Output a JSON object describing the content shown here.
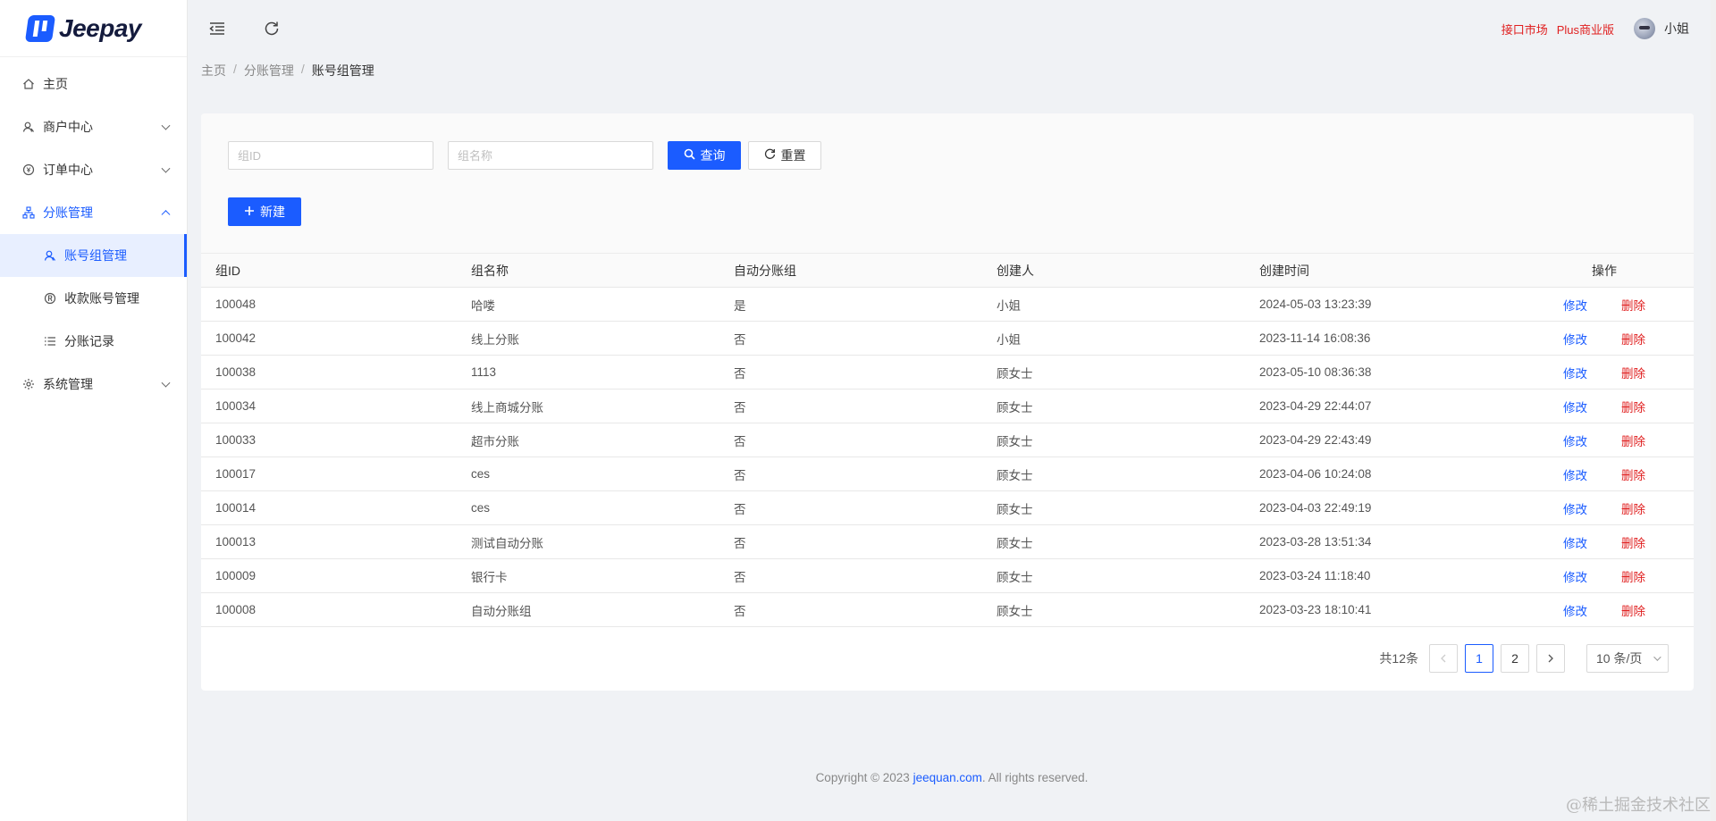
{
  "app": {
    "logo_text": "Jeepay"
  },
  "sidebar": {
    "items": [
      {
        "label": "主页",
        "icon": "home-icon"
      },
      {
        "label": "商户中心",
        "icon": "user-icon"
      },
      {
        "label": "订单中心",
        "icon": "yen-icon"
      },
      {
        "label": "分账管理",
        "icon": "cluster-icon"
      },
      {
        "label": "系统管理",
        "icon": "gear-icon"
      }
    ],
    "sub_items": [
      {
        "label": "账号组管理",
        "icon": "user-icon"
      },
      {
        "label": "收款账号管理",
        "icon": "registered-icon"
      },
      {
        "label": "分账记录",
        "icon": "list-icon"
      }
    ]
  },
  "header": {
    "links": [
      "接口市场",
      "Plus商业版"
    ],
    "username": "小姐"
  },
  "breadcrumb": [
    "主页",
    "分账管理",
    "账号组管理"
  ],
  "search": {
    "group_id_placeholder": "组ID",
    "group_name_placeholder": "组名称",
    "search_label": "查询",
    "reset_label": "重置",
    "new_label": "新建"
  },
  "table": {
    "columns": [
      "组ID",
      "组名称",
      "自动分账组",
      "创建人",
      "创建时间",
      "操作"
    ],
    "edit_label": "修改",
    "delete_label": "删除",
    "rows": [
      [
        "100048",
        "哈喽",
        "是",
        "小姐",
        "2024-05-03 13:23:39"
      ],
      [
        "100042",
        "线上分账",
        "否",
        "小姐",
        "2023-11-14 16:08:36"
      ],
      [
        "100038",
        "1113",
        "否",
        "顾女士",
        "2023-05-10 08:36:38"
      ],
      [
        "100034",
        "线上商城分账",
        "否",
        "顾女士",
        "2023-04-29 22:44:07"
      ],
      [
        "100033",
        "超市分账",
        "否",
        "顾女士",
        "2023-04-29 22:43:49"
      ],
      [
        "100017",
        "ces",
        "否",
        "顾女士",
        "2023-04-06 10:24:08"
      ],
      [
        "100014",
        "ces",
        "否",
        "顾女士",
        "2023-04-03 22:49:19"
      ],
      [
        "100013",
        "测试自动分账",
        "否",
        "顾女士",
        "2023-03-28 13:51:34"
      ],
      [
        "100009",
        "银行卡",
        "否",
        "顾女士",
        "2023-03-24 11:18:40"
      ],
      [
        "100008",
        "自动分账组",
        "否",
        "顾女士",
        "2023-03-23 18:10:41"
      ]
    ]
  },
  "pagination": {
    "total_label": "共12条",
    "pages": [
      "1",
      "2"
    ],
    "current_page": "1",
    "page_size_label": "10 条/页"
  },
  "footer": {
    "prefix": "Copyright © 2023 ",
    "link": "jeequan.com",
    "suffix": ". All rights reserved."
  },
  "watermark": "@稀土掘金技术社区",
  "colors": {
    "primary": "#1b5cff",
    "danger": "#e02020"
  }
}
